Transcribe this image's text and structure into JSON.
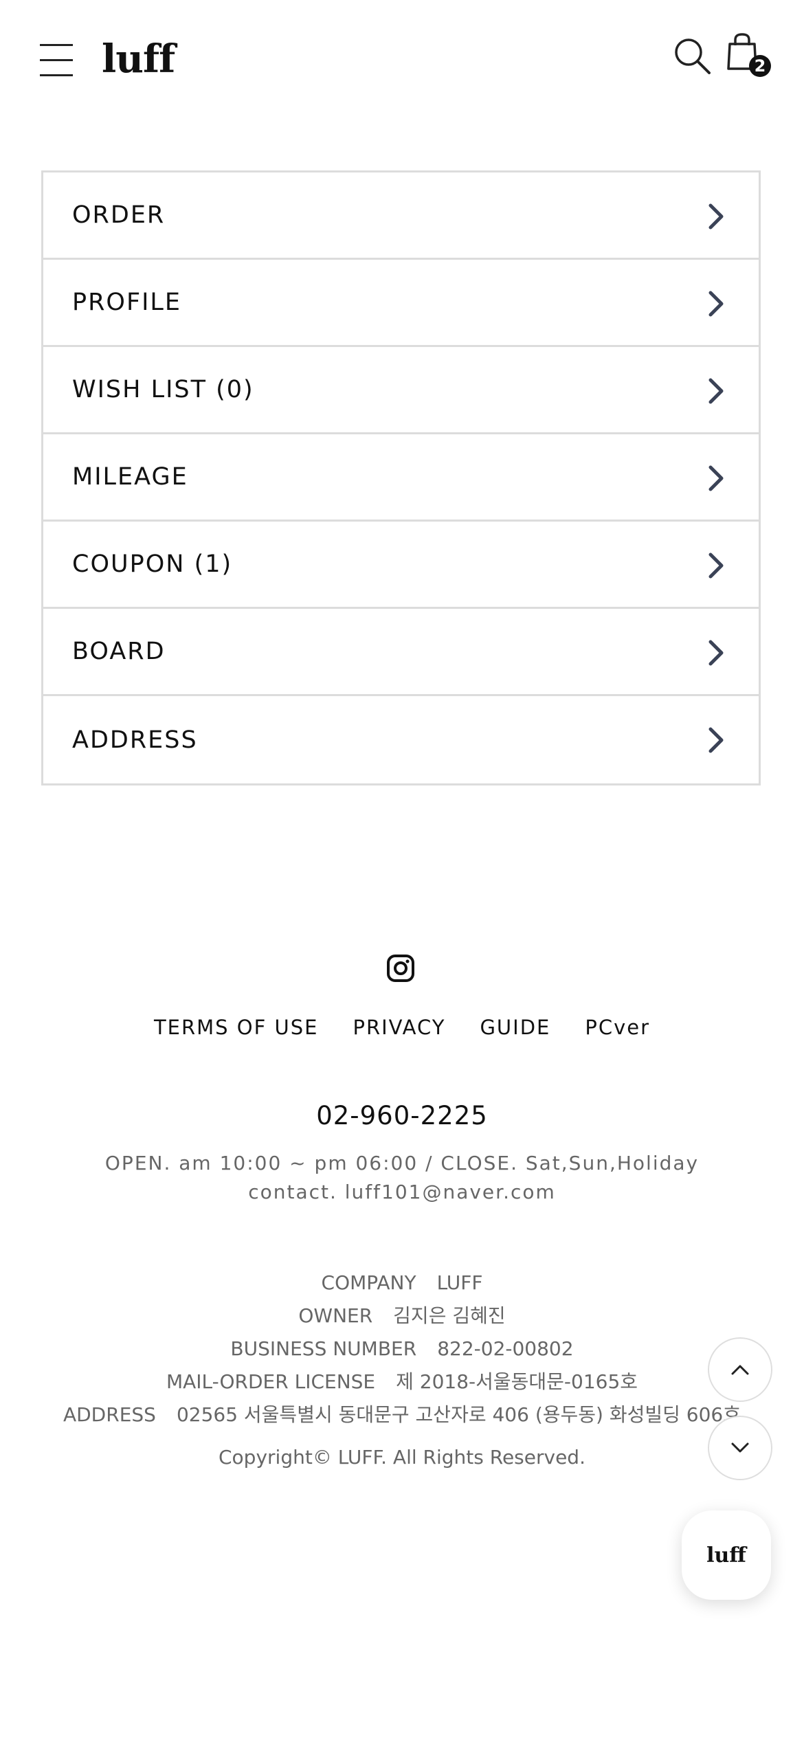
{
  "header": {
    "logo": "luff",
    "cart_count": "2"
  },
  "menu": {
    "items": [
      {
        "label": "ORDER"
      },
      {
        "label": "PROFILE"
      },
      {
        "label": "WISH LIST (0)"
      },
      {
        "label": "MILEAGE"
      },
      {
        "label": "COUPON (1)"
      },
      {
        "label": "BOARD"
      },
      {
        "label": "ADDRESS"
      }
    ]
  },
  "footer": {
    "links": [
      "TERMS OF USE",
      "PRIVACY",
      "GUIDE",
      "PCver"
    ],
    "phone": "02-960-2225",
    "hours": "OPEN. am 10:00 ~ pm 06:00 / CLOSE. Sat,Sun,Holiday",
    "contact": "contact. luff101@naver.com",
    "info": [
      {
        "key": "COMPANY",
        "value": "LUFF"
      },
      {
        "key": "OWNER",
        "value": "김지은 김혜진"
      },
      {
        "key": "BUSINESS NUMBER",
        "value": "822-02-00802"
      },
      {
        "key": "MAIL-ORDER LICENSE",
        "value": "제 2018-서울동대문-0165호"
      },
      {
        "key": "ADDRESS",
        "value": "02565 서울특별시 동대문구 고산자로 406 (용두동) 화성빌딩 606호"
      }
    ],
    "copyright": "Copyright© LUFF. All Rights Reserved."
  },
  "floating": {
    "chat_logo": "luff"
  },
  "icons": {
    "menu": "hamburger-icon",
    "search": "search-icon",
    "cart": "shopping-bag-icon",
    "row_arrow": "chevron-right-icon",
    "instagram": "instagram-icon",
    "scroll_up": "chevron-up-icon",
    "scroll_down": "chevron-down-icon"
  },
  "colors": {
    "text": "#111111",
    "muted": "#666666",
    "border": "#dcdcdc",
    "chevron": "#3a4256"
  }
}
